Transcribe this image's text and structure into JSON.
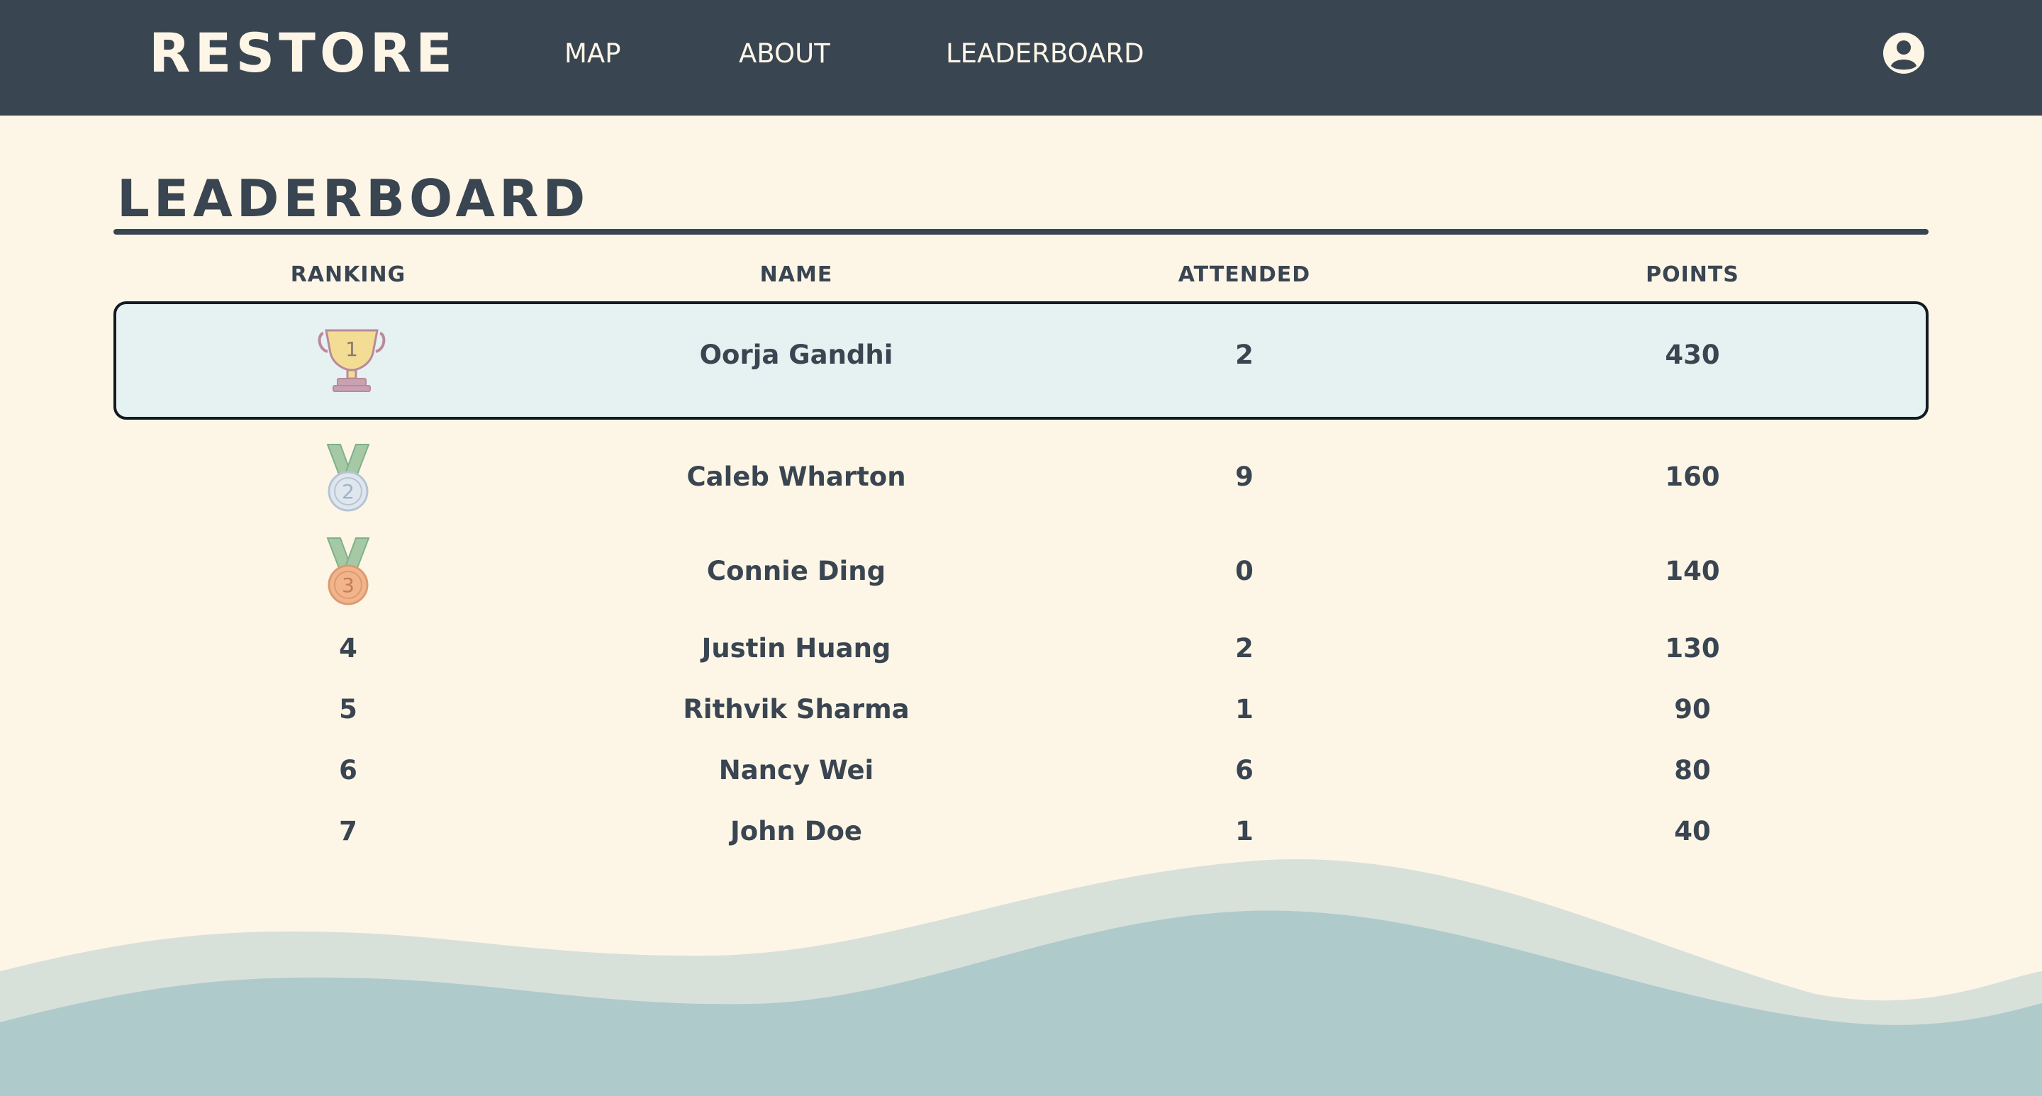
{
  "header": {
    "brand": "RESTORE",
    "nav": {
      "map": "MAP",
      "about": "ABOUT",
      "leaderboard": "LEADERBOARD"
    },
    "profile_icon": "account-circle-icon"
  },
  "page": {
    "title": "LEADERBOARD"
  },
  "table": {
    "columns": {
      "ranking": "RANKING",
      "name": "NAME",
      "attended": "ATTENDED",
      "points": "POINTS"
    },
    "rows": [
      {
        "rank": "1",
        "rank_icon": "trophy-icon",
        "name": "Oorja Gandhi",
        "attended": "2",
        "points": "430",
        "highlighted": true
      },
      {
        "rank": "2",
        "rank_icon": "silver-medal-icon",
        "name": "Caleb Wharton",
        "attended": "9",
        "points": "160"
      },
      {
        "rank": "3",
        "rank_icon": "bronze-medal-icon",
        "name": "Connie Ding",
        "attended": "0",
        "points": "140"
      },
      {
        "rank": "4",
        "name": "Justin Huang",
        "attended": "2",
        "points": "130"
      },
      {
        "rank": "5",
        "name": "Rithvik Sharma",
        "attended": "1",
        "points": "90"
      },
      {
        "rank": "6",
        "name": "Nancy Wei",
        "attended": "6",
        "points": "80"
      },
      {
        "rank": "7",
        "name": "John Doe",
        "attended": "1",
        "points": "40"
      }
    ]
  },
  "colors": {
    "navbar": "#3a4552",
    "background": "#fdf6e6",
    "highlight": "#e6f1f1",
    "wave_light": "#d8e0da",
    "wave_dark": "#afcacb"
  }
}
